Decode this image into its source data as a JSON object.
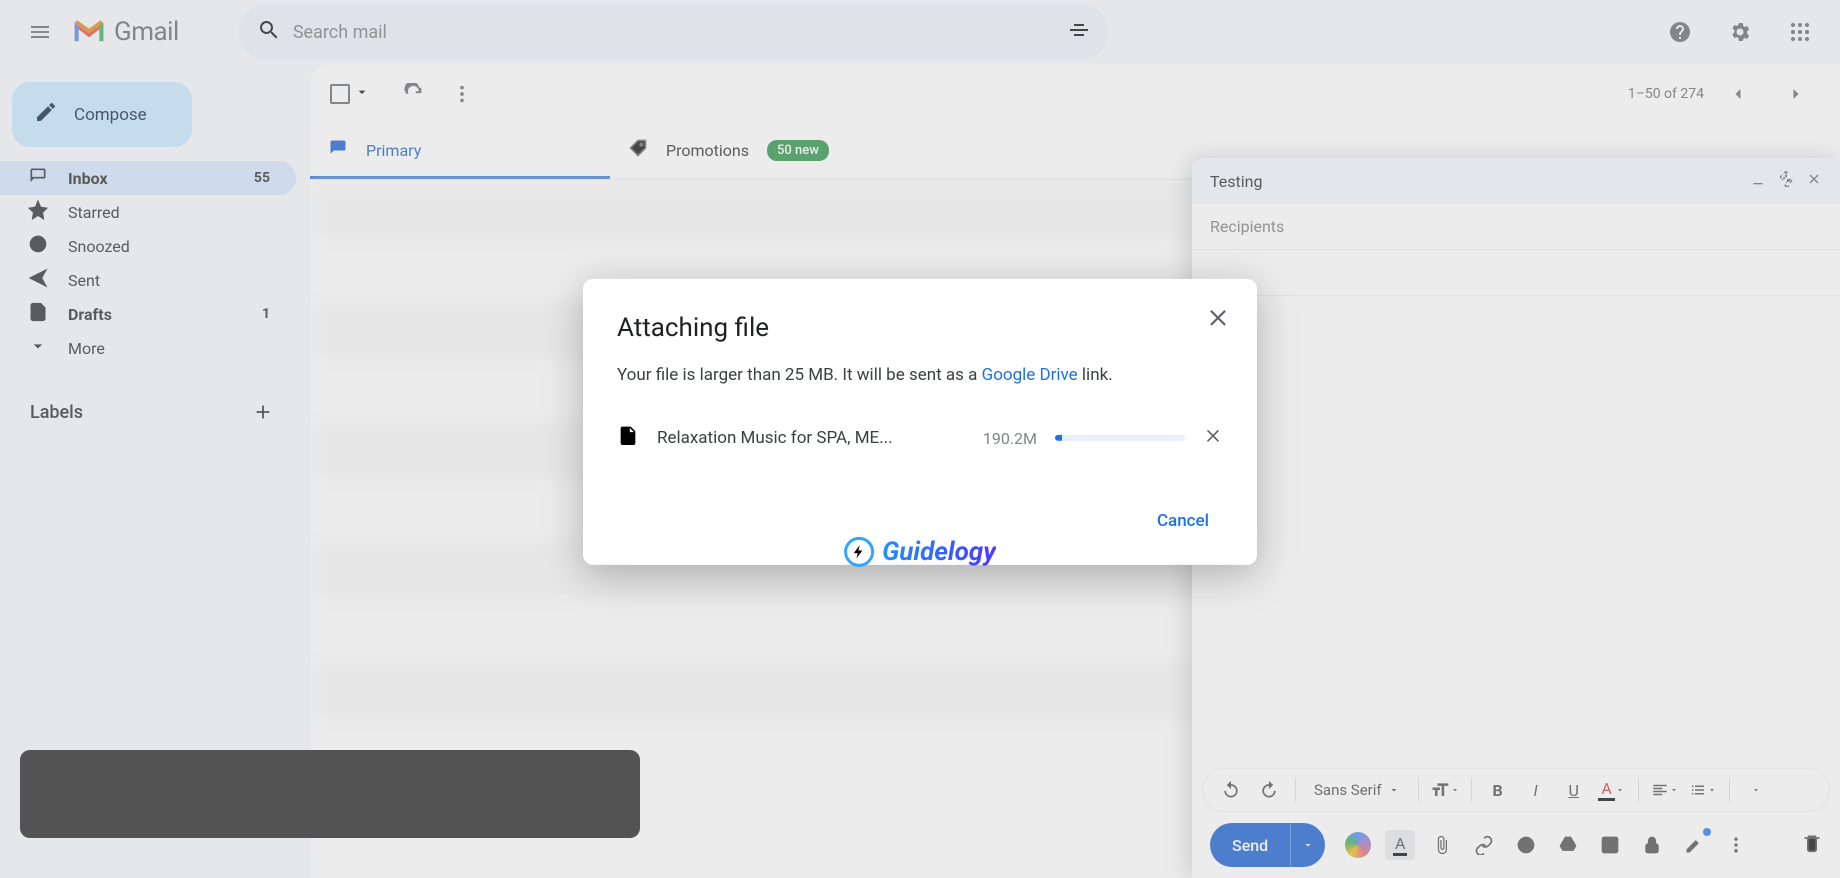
{
  "header": {
    "app_name": "Gmail",
    "search_placeholder": "Search mail"
  },
  "sidebar": {
    "compose_label": "Compose",
    "items": [
      {
        "label": "Inbox",
        "count": "55",
        "active": true
      },
      {
        "label": "Starred"
      },
      {
        "label": "Snoozed"
      },
      {
        "label": "Sent"
      },
      {
        "label": "Drafts",
        "count": "1"
      },
      {
        "label": "More"
      }
    ],
    "labels_header": "Labels"
  },
  "toolbar": {
    "pagination": "1–50 of 274"
  },
  "tabs": {
    "primary": "Primary",
    "promotions": "Promotions",
    "promotions_badge": "50 new"
  },
  "compose": {
    "subject": "Testing",
    "recipients_placeholder": "Recipients",
    "font_name": "Sans Serif",
    "send_label": "Send"
  },
  "dialog": {
    "title": "Attaching file",
    "message_prefix": "Your file is larger than 25 MB. It will be sent as a ",
    "drive_link_text": "Google Drive",
    "message_suffix": " link.",
    "file_name": "Relaxation Music for SPA, ME...",
    "file_size": "190.2M",
    "progress_percent": 5,
    "cancel_label": "Cancel"
  },
  "watermark": {
    "text": "Guidelogy"
  }
}
